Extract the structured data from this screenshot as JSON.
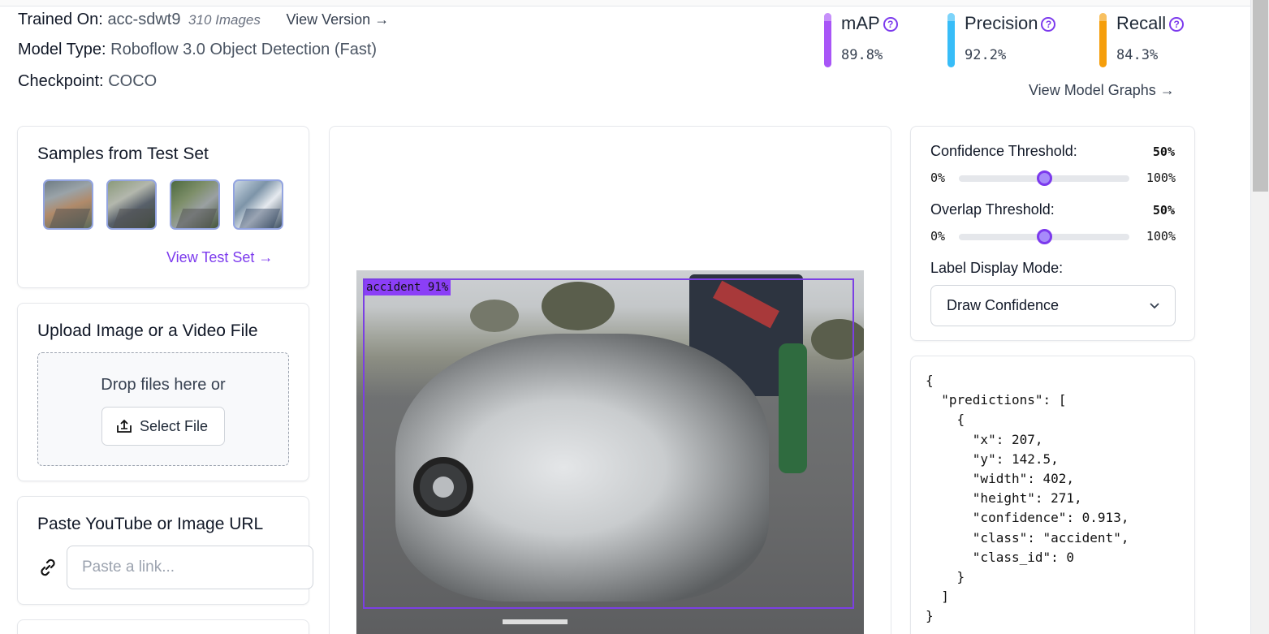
{
  "model_info": {
    "trained_on_label": "Trained On:",
    "trained_on_value": "acc-sdwt9",
    "images_count": "310 Images",
    "view_version": "View Version",
    "model_type_label": "Model Type:",
    "model_type_value": "Roboflow 3.0 Object Detection (Fast)",
    "checkpoint_label": "Checkpoint:",
    "checkpoint_value": "COCO"
  },
  "metrics": [
    {
      "label": "mAP",
      "value": "89.8%",
      "color": "#a855f7"
    },
    {
      "label": "Precision",
      "value": "92.2%",
      "color": "#38bdf8"
    },
    {
      "label": "Recall",
      "value": "84.3%",
      "color": "#f59e0b"
    }
  ],
  "view_model_graphs": "View Model Graphs",
  "samples": {
    "title": "Samples from Test Set",
    "view_test_set": "View Test Set"
  },
  "upload": {
    "title": "Upload Image or a Video File",
    "drop_text": "Drop files here or",
    "select_file": "Select File"
  },
  "paste_url": {
    "title": "Paste YouTube or Image URL",
    "placeholder": "Paste a link..."
  },
  "preview": {
    "label": "accident 91%"
  },
  "settings": {
    "confidence_label": "Confidence Threshold:",
    "confidence_value": "50%",
    "confidence_level": 0.5,
    "overlap_label": "Overlap Threshold:",
    "overlap_value": "50%",
    "overlap_level": 0.5,
    "min": "0%",
    "max": "100%",
    "label_mode_label": "Label Display Mode:",
    "label_mode_value": "Draw Confidence"
  },
  "json_output": "{\n  \"predictions\": [\n    {\n      \"x\": 207,\n      \"y\": 142.5,\n      \"width\": 402,\n      \"height\": 271,\n      \"confidence\": 0.913,\n      \"class\": \"accident\",\n      \"class_id\": 0\n    }\n  ]\n}"
}
